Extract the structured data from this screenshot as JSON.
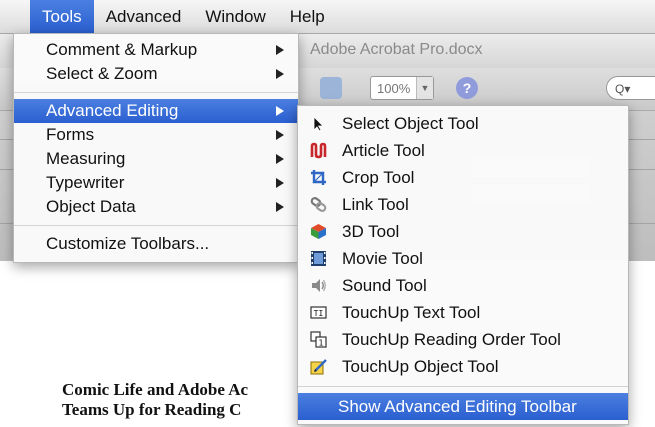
{
  "menubar": {
    "items": [
      "Tools",
      "Advanced",
      "Window",
      "Help"
    ]
  },
  "window": {
    "doc_title": "Adobe Acrobat Pro.docx",
    "zoom": "100%",
    "search_placeholder": "Q▾"
  },
  "tools_menu": {
    "items": [
      {
        "label": "Comment & Markup",
        "submenu": true
      },
      {
        "label": "Select & Zoom",
        "submenu": true
      },
      {
        "label": "Advanced Editing",
        "submenu": true,
        "selected": true
      },
      {
        "label": "Forms",
        "submenu": true
      },
      {
        "label": "Measuring",
        "submenu": true
      },
      {
        "label": "Typewriter",
        "submenu": true
      },
      {
        "label": "Object Data",
        "submenu": true
      },
      {
        "label": "Customize Toolbars...",
        "submenu": false
      }
    ]
  },
  "advanced_editing_menu": {
    "items": [
      {
        "label": "Select Object Tool",
        "icon": "cursor-arrow-icon"
      },
      {
        "label": "Article Tool",
        "icon": "article-icon"
      },
      {
        "label": "Crop Tool",
        "icon": "crop-icon"
      },
      {
        "label": "Link Tool",
        "icon": "link-icon"
      },
      {
        "label": "3D Tool",
        "icon": "3d-icon"
      },
      {
        "label": "Movie Tool",
        "icon": "movie-icon"
      },
      {
        "label": "Sound Tool",
        "icon": "sound-icon"
      },
      {
        "label": "TouchUp Text Tool",
        "icon": "touchup-text-icon"
      },
      {
        "label": "TouchUp Reading Order Tool",
        "icon": "reading-order-icon"
      },
      {
        "label": "TouchUp Object Tool",
        "icon": "touchup-object-icon"
      },
      {
        "label": "Show Advanced Editing Toolbar",
        "icon": ""
      }
    ]
  },
  "document": {
    "line1": "Comic Life and Adobe Ac",
    "line2": "Teams Up for Reading C"
  },
  "colors": {
    "accent": "#2a5fd0",
    "menu_bg": "#fafafa"
  }
}
